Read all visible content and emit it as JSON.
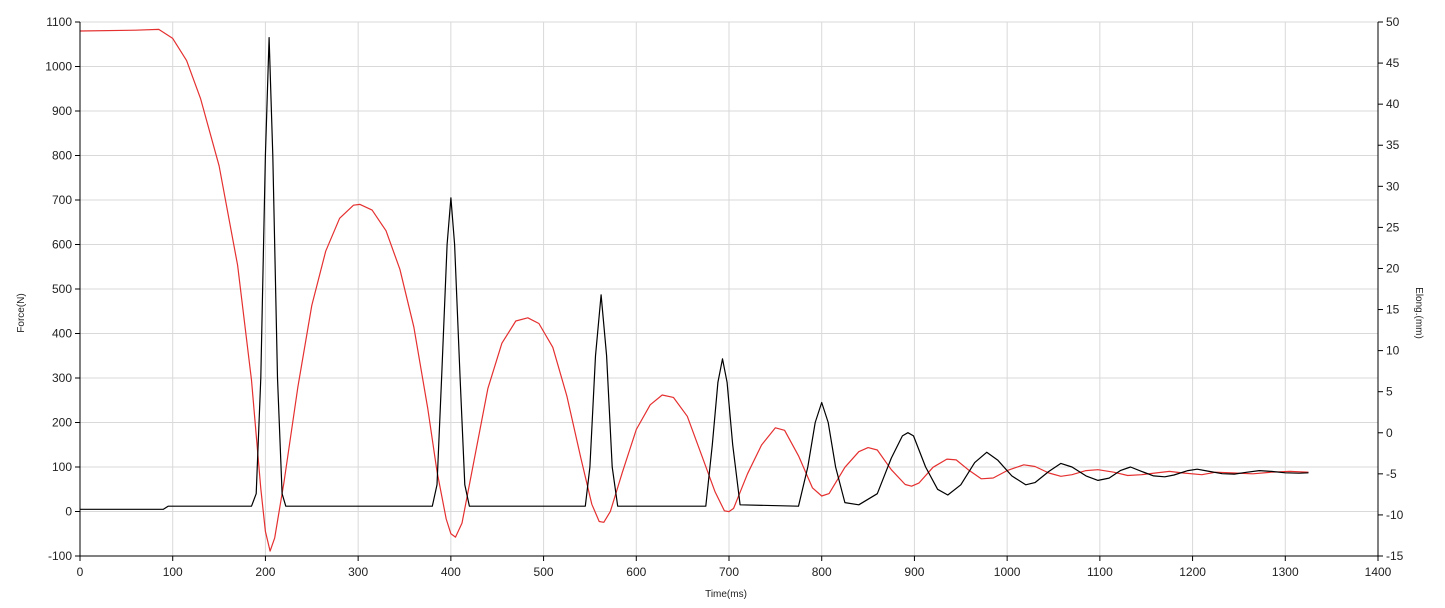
{
  "chart_data": {
    "type": "line",
    "xlabel": "Time(ms)",
    "ylabel": "Force(N)",
    "y2label": "Elong.(mm)",
    "xlim": [
      0,
      1400
    ],
    "ylim": [
      -100,
      1100
    ],
    "y2lim": [
      -15,
      50
    ],
    "x_ticks": [
      "0",
      "100",
      "200",
      "300",
      "400",
      "500",
      "600",
      "700",
      "800",
      "900",
      "1000",
      "1100",
      "1200",
      "1300",
      "1400"
    ],
    "y_ticks": [
      "-100",
      "0",
      "100",
      "200",
      "300",
      "400",
      "500",
      "600",
      "700",
      "800",
      "900",
      "1000",
      "1100"
    ],
    "y2_ticks": [
      "-15",
      "-10",
      "-5",
      "0",
      "5",
      "10",
      "15",
      "20",
      "25",
      "30",
      "35",
      "40",
      "45",
      "50"
    ],
    "grid": true,
    "colors": {
      "force": "#000000",
      "elong": "#e53030",
      "grid": "#d9d9d9",
      "axis": "#000000"
    },
    "series": [
      {
        "axis": "left",
        "color": "#000000",
        "points": [
          [
            0,
            5
          ],
          [
            90,
            5
          ],
          [
            95,
            12
          ],
          [
            185,
            12
          ],
          [
            190,
            40
          ],
          [
            195,
            300
          ],
          [
            200,
            800
          ],
          [
            204,
            1065
          ],
          [
            208,
            800
          ],
          [
            213,
            300
          ],
          [
            218,
            40
          ],
          [
            222,
            12
          ],
          [
            380,
            12
          ],
          [
            385,
            60
          ],
          [
            390,
            300
          ],
          [
            396,
            600
          ],
          [
            400,
            705
          ],
          [
            404,
            600
          ],
          [
            410,
            300
          ],
          [
            415,
            60
          ],
          [
            420,
            12
          ],
          [
            545,
            12
          ],
          [
            550,
            100
          ],
          [
            556,
            350
          ],
          [
            562,
            487
          ],
          [
            568,
            350
          ],
          [
            574,
            100
          ],
          [
            580,
            12
          ],
          [
            675,
            12
          ],
          [
            682,
            150
          ],
          [
            688,
            290
          ],
          [
            693,
            343
          ],
          [
            698,
            290
          ],
          [
            704,
            150
          ],
          [
            712,
            15
          ],
          [
            775,
            12
          ],
          [
            785,
            100
          ],
          [
            793,
            200
          ],
          [
            800,
            245
          ],
          [
            807,
            200
          ],
          [
            815,
            100
          ],
          [
            825,
            20
          ],
          [
            840,
            15
          ],
          [
            860,
            40
          ],
          [
            875,
            120
          ],
          [
            887,
            170
          ],
          [
            893,
            177
          ],
          [
            899,
            170
          ],
          [
            912,
            100
          ],
          [
            925,
            50
          ],
          [
            936,
            37
          ],
          [
            950,
            60
          ],
          [
            965,
            110
          ],
          [
            978,
            133
          ],
          [
            990,
            115
          ],
          [
            1005,
            80
          ],
          [
            1020,
            60
          ],
          [
            1030,
            65
          ],
          [
            1045,
            90
          ],
          [
            1058,
            108
          ],
          [
            1070,
            100
          ],
          [
            1085,
            80
          ],
          [
            1098,
            70
          ],
          [
            1110,
            75
          ],
          [
            1122,
            92
          ],
          [
            1133,
            100
          ],
          [
            1145,
            90
          ],
          [
            1158,
            80
          ],
          [
            1170,
            78
          ],
          [
            1180,
            82
          ],
          [
            1195,
            92
          ],
          [
            1205,
            95
          ],
          [
            1218,
            90
          ],
          [
            1232,
            85
          ],
          [
            1245,
            84
          ],
          [
            1258,
            88
          ],
          [
            1272,
            92
          ],
          [
            1285,
            90
          ],
          [
            1300,
            87
          ],
          [
            1315,
            86
          ],
          [
            1325,
            87
          ]
        ]
      },
      {
        "axis": "right",
        "color": "#e53030",
        "points": [
          [
            0,
            48.9
          ],
          [
            60,
            49.0
          ],
          [
            85,
            49.1
          ],
          [
            100,
            48.0
          ],
          [
            115,
            45.3
          ],
          [
            130,
            40.7
          ],
          [
            150,
            32.5
          ],
          [
            170,
            20.4
          ],
          [
            185,
            6.4
          ],
          [
            195,
            -6.8
          ],
          [
            200,
            -12.0
          ],
          [
            205,
            -14.4
          ],
          [
            210,
            -12.8
          ],
          [
            220,
            -6.0
          ],
          [
            235,
            5.6
          ],
          [
            250,
            15.5
          ],
          [
            265,
            22.1
          ],
          [
            280,
            26.1
          ],
          [
            295,
            27.7
          ],
          [
            302,
            27.8
          ],
          [
            315,
            27.1
          ],
          [
            330,
            24.6
          ],
          [
            345,
            19.9
          ],
          [
            360,
            12.9
          ],
          [
            375,
            3.0
          ],
          [
            385,
            -4.7
          ],
          [
            395,
            -10.5
          ],
          [
            400,
            -12.3
          ],
          [
            405,
            -12.7
          ],
          [
            412,
            -11.0
          ],
          [
            425,
            -3.4
          ],
          [
            440,
            5.4
          ],
          [
            455,
            10.9
          ],
          [
            470,
            13.6
          ],
          [
            483,
            14.0
          ],
          [
            495,
            13.3
          ],
          [
            510,
            10.4
          ],
          [
            525,
            4.5
          ],
          [
            540,
            -3.0
          ],
          [
            552,
            -8.7
          ],
          [
            560,
            -10.8
          ],
          [
            565,
            -10.9
          ],
          [
            572,
            -9.6
          ],
          [
            585,
            -4.8
          ],
          [
            600,
            0.4
          ],
          [
            615,
            3.4
          ],
          [
            628,
            4.6
          ],
          [
            640,
            4.3
          ],
          [
            655,
            2.0
          ],
          [
            670,
            -2.6
          ],
          [
            685,
            -7.2
          ],
          [
            695,
            -9.5
          ],
          [
            700,
            -9.6
          ],
          [
            705,
            -9.2
          ],
          [
            720,
            -5.0
          ],
          [
            735,
            -1.5
          ],
          [
            750,
            0.6
          ],
          [
            760,
            0.3
          ],
          [
            775,
            -2.8
          ],
          [
            790,
            -6.7
          ],
          [
            800,
            -7.7
          ],
          [
            808,
            -7.4
          ],
          [
            825,
            -4.2
          ],
          [
            840,
            -2.3
          ],
          [
            850,
            -1.8
          ],
          [
            860,
            -2.1
          ],
          [
            875,
            -4.5
          ],
          [
            890,
            -6.3
          ],
          [
            897,
            -6.5
          ],
          [
            905,
            -6.1
          ],
          [
            920,
            -4.2
          ],
          [
            935,
            -3.2
          ],
          [
            945,
            -3.3
          ],
          [
            958,
            -4.5
          ],
          [
            972,
            -5.6
          ],
          [
            985,
            -5.5
          ],
          [
            1000,
            -4.6
          ],
          [
            1018,
            -3.9
          ],
          [
            1030,
            -4.1
          ],
          [
            1045,
            -4.9
          ],
          [
            1058,
            -5.3
          ],
          [
            1070,
            -5.1
          ],
          [
            1085,
            -4.6
          ],
          [
            1098,
            -4.5
          ],
          [
            1115,
            -4.8
          ],
          [
            1130,
            -5.2
          ],
          [
            1145,
            -5.1
          ],
          [
            1160,
            -4.9
          ],
          [
            1175,
            -4.7
          ],
          [
            1190,
            -4.9
          ],
          [
            1210,
            -5.1
          ],
          [
            1225,
            -4.8
          ],
          [
            1245,
            -4.9
          ],
          [
            1265,
            -5.0
          ],
          [
            1285,
            -4.8
          ],
          [
            1305,
            -4.7
          ],
          [
            1325,
            -4.8
          ]
        ]
      }
    ]
  }
}
